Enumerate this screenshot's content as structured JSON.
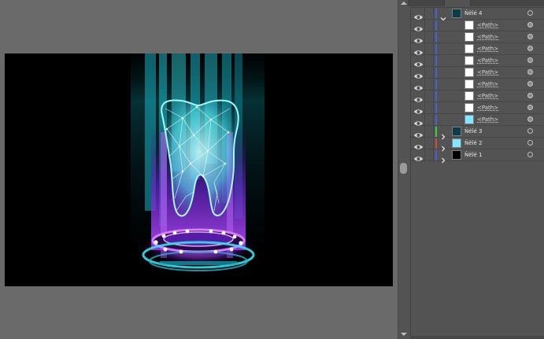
{
  "layers": [
    {
      "name": "Ñëîé 4",
      "kind": "layer",
      "expanded": true,
      "color": "#4a5fd1",
      "thumb": "tooth",
      "target_filled": false
    },
    {
      "name": "<Path>",
      "kind": "path",
      "color": "#4a5fd1",
      "thumb": "blank",
      "target_filled": true
    },
    {
      "name": "<Path>",
      "kind": "path",
      "color": "#4a5fd1",
      "thumb": "blank",
      "target_filled": true
    },
    {
      "name": "<Path>",
      "kind": "path",
      "color": "#4a5fd1",
      "thumb": "blank",
      "target_filled": true
    },
    {
      "name": "<Path>",
      "kind": "path",
      "color": "#4a5fd1",
      "thumb": "blank",
      "target_filled": true
    },
    {
      "name": "<Path>",
      "kind": "path",
      "color": "#4a5fd1",
      "thumb": "blank",
      "target_filled": true
    },
    {
      "name": "<Path>",
      "kind": "path",
      "color": "#4a5fd1",
      "thumb": "blank",
      "target_filled": true
    },
    {
      "name": "<Path>",
      "kind": "path",
      "color": "#4a5fd1",
      "thumb": "blank",
      "target_filled": true
    },
    {
      "name": "<Path>",
      "kind": "path",
      "color": "#4a5fd1",
      "thumb": "blank",
      "target_filled": true
    },
    {
      "name": "<Path>",
      "kind": "path",
      "color": "#4a5fd1",
      "thumb": "glow",
      "target_filled": true
    },
    {
      "name": "Ñëîé 3",
      "kind": "layer",
      "expanded": false,
      "color": "#3fd13f",
      "thumb": "tooth",
      "target_filled": false
    },
    {
      "name": "Ñëîé 2",
      "kind": "layer",
      "expanded": false,
      "color": "#d14a3f",
      "thumb": "glow",
      "target_filled": false
    },
    {
      "name": "Ñëîé 1",
      "kind": "layer",
      "expanded": false,
      "color": "#4a5fd1",
      "thumb": "black",
      "target_filled": false
    }
  ],
  "icons": {
    "visibility": "eye-icon",
    "expand": "chevron-down-icon",
    "collapse": "chevron-right-icon",
    "target": "target-circle-icon"
  },
  "colors": {
    "canvas_bg": "#696969",
    "artboard_bg": "#000000",
    "panel_bg": "#535353",
    "hologram_cyan": "#5ff7ff",
    "hologram_purple": "#a23cff"
  }
}
